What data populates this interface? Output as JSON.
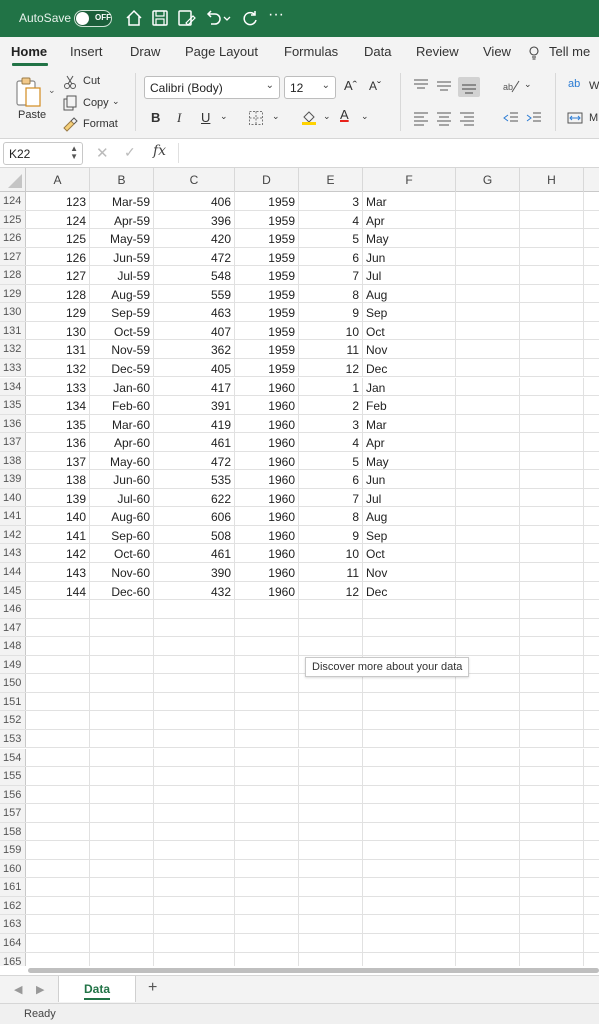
{
  "titlebar": {
    "autosave_label": "AutoSave",
    "autosave_state": "OFF",
    "icons": [
      "home-icon",
      "save-icon",
      "edit-save-icon",
      "undo-icon",
      "redo-icon",
      "more-icon"
    ],
    "more": "···"
  },
  "tabs": [
    "Home",
    "Insert",
    "Draw",
    "Page Layout",
    "Formulas",
    "Data",
    "Review",
    "View",
    "Tell me"
  ],
  "ribbon": {
    "paste": "Paste",
    "cut": "Cut",
    "copy": "Copy",
    "format": "Format",
    "font_name": "Calibri (Body)",
    "font_size": "12",
    "bold": "B",
    "italic": "I",
    "underline": "U",
    "grow": "Aˆ",
    "shrink": "Aˇ",
    "font_color_letter": "A",
    "wrap_label": "W",
    "merge_label": "M",
    "wrap_glyph": "ab",
    "accent_red": "#e8221b",
    "accent_yellow": "#ffd200"
  },
  "formula_bar": {
    "name_box": "K22",
    "cancel": "✕",
    "enter": "✓",
    "fx": "fx",
    "content": ""
  },
  "columns": [
    "A",
    "B",
    "C",
    "D",
    "E",
    "F",
    "G",
    "H"
  ],
  "rows": [
    {
      "n": "124",
      "A": "123",
      "B": "Mar-59",
      "C": "406",
      "D": "1959",
      "E": "3",
      "F": "Mar"
    },
    {
      "n": "125",
      "A": "124",
      "B": "Apr-59",
      "C": "396",
      "D": "1959",
      "E": "4",
      "F": "Apr"
    },
    {
      "n": "126",
      "A": "125",
      "B": "May-59",
      "C": "420",
      "D": "1959",
      "E": "5",
      "F": "May"
    },
    {
      "n": "127",
      "A": "126",
      "B": "Jun-59",
      "C": "472",
      "D": "1959",
      "E": "6",
      "F": "Jun"
    },
    {
      "n": "128",
      "A": "127",
      "B": "Jul-59",
      "C": "548",
      "D": "1959",
      "E": "7",
      "F": "Jul"
    },
    {
      "n": "129",
      "A": "128",
      "B": "Aug-59",
      "C": "559",
      "D": "1959",
      "E": "8",
      "F": "Aug"
    },
    {
      "n": "130",
      "A": "129",
      "B": "Sep-59",
      "C": "463",
      "D": "1959",
      "E": "9",
      "F": "Sep"
    },
    {
      "n": "131",
      "A": "130",
      "B": "Oct-59",
      "C": "407",
      "D": "1959",
      "E": "10",
      "F": "Oct"
    },
    {
      "n": "132",
      "A": "131",
      "B": "Nov-59",
      "C": "362",
      "D": "1959",
      "E": "11",
      "F": "Nov"
    },
    {
      "n": "133",
      "A": "132",
      "B": "Dec-59",
      "C": "405",
      "D": "1959",
      "E": "12",
      "F": "Dec"
    },
    {
      "n": "134",
      "A": "133",
      "B": "Jan-60",
      "C": "417",
      "D": "1960",
      "E": "1",
      "F": "Jan"
    },
    {
      "n": "135",
      "A": "134",
      "B": "Feb-60",
      "C": "391",
      "D": "1960",
      "E": "2",
      "F": "Feb"
    },
    {
      "n": "136",
      "A": "135",
      "B": "Mar-60",
      "C": "419",
      "D": "1960",
      "E": "3",
      "F": "Mar"
    },
    {
      "n": "137",
      "A": "136",
      "B": "Apr-60",
      "C": "461",
      "D": "1960",
      "E": "4",
      "F": "Apr"
    },
    {
      "n": "138",
      "A": "137",
      "B": "May-60",
      "C": "472",
      "D": "1960",
      "E": "5",
      "F": "May"
    },
    {
      "n": "139",
      "A": "138",
      "B": "Jun-60",
      "C": "535",
      "D": "1960",
      "E": "6",
      "F": "Jun"
    },
    {
      "n": "140",
      "A": "139",
      "B": "Jul-60",
      "C": "622",
      "D": "1960",
      "E": "7",
      "F": "Jul"
    },
    {
      "n": "141",
      "A": "140",
      "B": "Aug-60",
      "C": "606",
      "D": "1960",
      "E": "8",
      "F": "Aug"
    },
    {
      "n": "142",
      "A": "141",
      "B": "Sep-60",
      "C": "508",
      "D": "1960",
      "E": "9",
      "F": "Sep"
    },
    {
      "n": "143",
      "A": "142",
      "B": "Oct-60",
      "C": "461",
      "D": "1960",
      "E": "10",
      "F": "Oct"
    },
    {
      "n": "144",
      "A": "143",
      "B": "Nov-60",
      "C": "390",
      "D": "1960",
      "E": "11",
      "F": "Nov"
    },
    {
      "n": "145",
      "A": "144",
      "B": "Dec-60",
      "C": "432",
      "D": "1960",
      "E": "12",
      "F": "Dec"
    },
    {
      "n": "146"
    },
    {
      "n": "147"
    },
    {
      "n": "148"
    },
    {
      "n": "149"
    },
    {
      "n": "150"
    },
    {
      "n": "151"
    },
    {
      "n": "152"
    },
    {
      "n": "153"
    },
    {
      "n": "154"
    },
    {
      "n": "155"
    },
    {
      "n": "156"
    },
    {
      "n": "157"
    },
    {
      "n": "158"
    },
    {
      "n": "159"
    },
    {
      "n": "160"
    },
    {
      "n": "161"
    },
    {
      "n": "162"
    },
    {
      "n": "163"
    },
    {
      "n": "164"
    },
    {
      "n": "165"
    }
  ],
  "tooltip": "Discover more about your data",
  "sheet_tabs": [
    "Data"
  ],
  "add_sheet": "+",
  "status": "Ready",
  "colors": {
    "brand": "#217346",
    "ribbon_bg": "#f3f3f3"
  }
}
